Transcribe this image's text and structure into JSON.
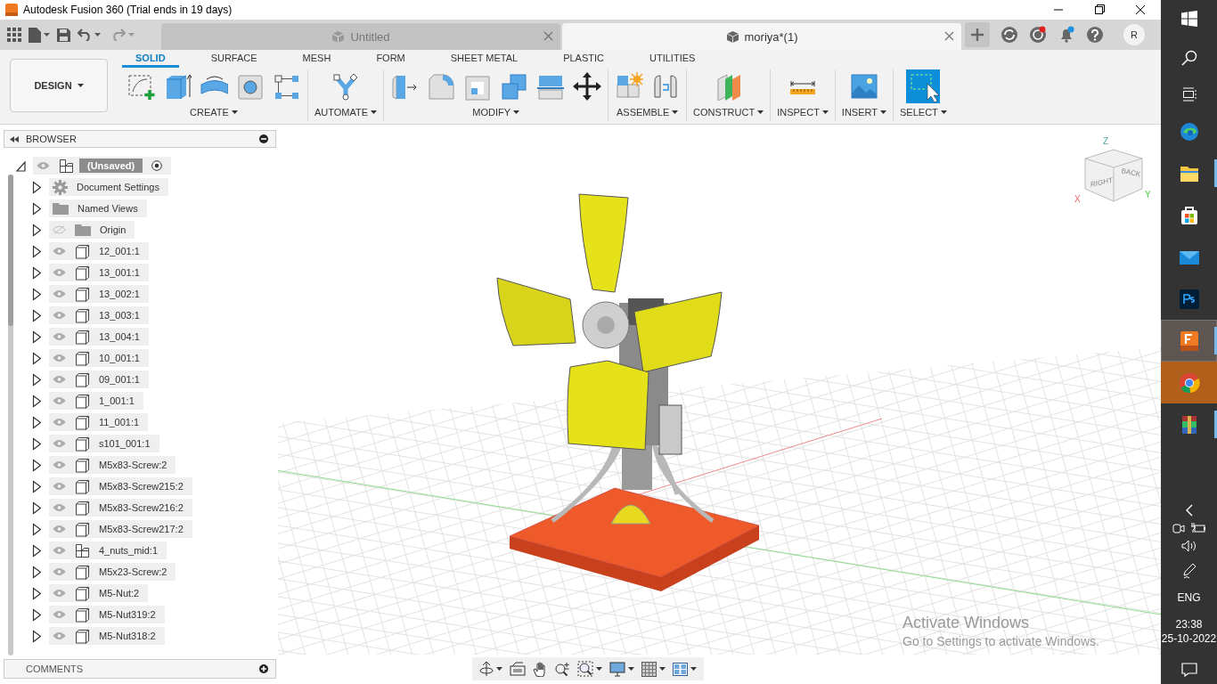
{
  "window": {
    "title": "Autodesk Fusion 360 (Trial ends in 19 days)"
  },
  "doc_tabs": [
    {
      "label": "Untitled",
      "selected": false
    },
    {
      "label": "moriya*(1)",
      "selected": true
    }
  ],
  "profile": {
    "initial": "R"
  },
  "workspace": {
    "label": "DESIGN"
  },
  "ribbon_tabs": [
    {
      "label": "SOLID",
      "selected": true
    },
    {
      "label": "SURFACE",
      "selected": false
    },
    {
      "label": "MESH",
      "selected": false
    },
    {
      "label": "FORM",
      "selected": false
    },
    {
      "label": "SHEET METAL",
      "selected": false
    },
    {
      "label": "PLASTIC",
      "selected": false
    },
    {
      "label": "UTILITIES",
      "selected": false
    }
  ],
  "tool_groups": [
    {
      "label": "CREATE",
      "kind": "create"
    },
    {
      "label": "AUTOMATE",
      "kind": "automate"
    },
    {
      "label": "MODIFY",
      "kind": "modify"
    },
    {
      "label": "ASSEMBLE",
      "kind": "assemble"
    },
    {
      "label": "CONSTRUCT",
      "kind": "construct"
    },
    {
      "label": "INSPECT",
      "kind": "inspect"
    },
    {
      "label": "INSERT",
      "kind": "insert"
    },
    {
      "label": "SELECT",
      "kind": "select"
    }
  ],
  "browser": {
    "title": "BROWSER",
    "root": {
      "label": "(Unsaved)",
      "expanded": true,
      "visible": true
    },
    "items": [
      {
        "label": "Document Settings",
        "kind": "settings",
        "expanded": false
      },
      {
        "label": "Named Views",
        "kind": "views",
        "expanded": false
      },
      {
        "label": "Origin",
        "kind": "folder",
        "expanded": false,
        "visible": false
      },
      {
        "label": "12_001:1",
        "kind": "body",
        "expanded": false,
        "visible": true
      },
      {
        "label": "13_001:1",
        "kind": "body",
        "expanded": false,
        "visible": true
      },
      {
        "label": "13_002:1",
        "kind": "body",
        "expanded": false,
        "visible": true
      },
      {
        "label": "13_003:1",
        "kind": "body",
        "expanded": false,
        "visible": true
      },
      {
        "label": "13_004:1",
        "kind": "body",
        "expanded": false,
        "visible": true
      },
      {
        "label": "10_001:1",
        "kind": "body",
        "expanded": false,
        "visible": true
      },
      {
        "label": "09_001:1",
        "kind": "body",
        "expanded": false,
        "visible": true
      },
      {
        "label": "1_001:1",
        "kind": "body",
        "expanded": false,
        "visible": true
      },
      {
        "label": "11_001:1",
        "kind": "body",
        "expanded": false,
        "visible": true
      },
      {
        "label": "s101_001:1",
        "kind": "body",
        "expanded": false,
        "visible": true
      },
      {
        "label": "M5x83-Screw:2",
        "kind": "body",
        "expanded": false,
        "visible": true
      },
      {
        "label": "M5x83-Screw215:2",
        "kind": "body",
        "expanded": false,
        "visible": true
      },
      {
        "label": "M5x83-Screw216:2",
        "kind": "body",
        "expanded": false,
        "visible": true
      },
      {
        "label": "M5x83-Screw217:2",
        "kind": "body",
        "expanded": false,
        "visible": true
      },
      {
        "label": "4_nuts_mid:1",
        "kind": "assembly",
        "expanded": false,
        "visible": true
      },
      {
        "label": "M5x23-Screw:2",
        "kind": "body",
        "expanded": false,
        "visible": true
      },
      {
        "label": "M5-Nut:2",
        "kind": "body",
        "expanded": false,
        "visible": true
      },
      {
        "label": "M5-Nut319:2",
        "kind": "body",
        "expanded": false,
        "visible": true
      },
      {
        "label": "M5-Nut318:2",
        "kind": "body",
        "expanded": false,
        "visible": true
      }
    ]
  },
  "comments": {
    "title": "COMMENTS"
  },
  "viewcube": {
    "faces": [
      "RIGHT",
      "BACK"
    ],
    "axes": [
      "Z",
      "X",
      "Y"
    ]
  },
  "activation": {
    "title": "Activate Windows",
    "subtitle": "Go to Settings to activate Windows."
  },
  "taskbar": {
    "apps": [
      {
        "kind": "edge",
        "running": false,
        "selected": false,
        "attention": false
      },
      {
        "kind": "explorer",
        "running": true,
        "selected": false,
        "attention": false
      },
      {
        "kind": "store",
        "running": false,
        "selected": false,
        "attention": false
      },
      {
        "kind": "mail",
        "running": false,
        "selected": false,
        "attention": false
      },
      {
        "kind": "photoshop",
        "running": false,
        "selected": false,
        "attention": false
      },
      {
        "kind": "fusion",
        "running": true,
        "selected": true,
        "attention": false
      },
      {
        "kind": "chrome",
        "running": false,
        "selected": false,
        "attention": true
      },
      {
        "kind": "winrar",
        "running": true,
        "selected": false,
        "attention": false
      }
    ],
    "language": "ENG",
    "time": "23:38",
    "date": "25-10-2022"
  }
}
